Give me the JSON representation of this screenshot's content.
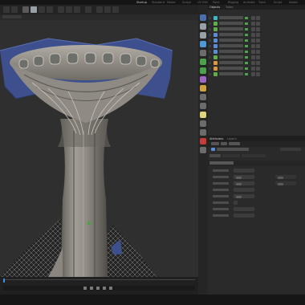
{
  "menu_tabs": [
    "Startup",
    "Standard",
    "Model",
    "Sculpt",
    "UV Edit",
    "Paint",
    "Rigging",
    "Animate",
    "Track",
    "Script",
    "Nodes"
  ],
  "active_menu_tab": "Startup",
  "viewport": {
    "colors": {
      "sky": "#2f2f2f",
      "ground": "#2b2b2b",
      "grid": "#3a3a3a",
      "cloth": "#3d4f8c",
      "concrete": "#8d8a83",
      "window": "#6d6f6a"
    }
  },
  "object_manager": {
    "tabs": [
      "Objects",
      "Takes"
    ],
    "active_tab": "Objects",
    "objects": [
      {
        "icon": "cyan"
      },
      {
        "icon": "green"
      },
      {
        "icon": "green"
      },
      {
        "icon": "blue"
      },
      {
        "icon": "blue"
      },
      {
        "icon": "blue"
      },
      {
        "icon": "blue"
      },
      {
        "icon": "green"
      },
      {
        "icon": "orange"
      },
      {
        "icon": "orange"
      },
      {
        "icon": "green"
      }
    ]
  },
  "attribute_manager": {
    "tabs": [
      "Attributes",
      "Layers"
    ],
    "active_tab": "Attributes",
    "section_tabs": [
      "Basic",
      "Coordinates",
      "Object"
    ],
    "dropdowns": [
      "Default",
      "Default",
      "Enabled"
    ],
    "toggle_values": [
      "On",
      "On"
    ]
  },
  "icons": [
    "move-icon",
    "rotate-icon",
    "scale-icon",
    "cube-icon",
    "pen-icon",
    "subdivision-icon",
    "cloner-icon",
    "bend-icon",
    "light-icon",
    "camera-icon",
    "render-icon",
    "material-icon",
    "snap-icon",
    "workplane-icon",
    "play-icon"
  ]
}
